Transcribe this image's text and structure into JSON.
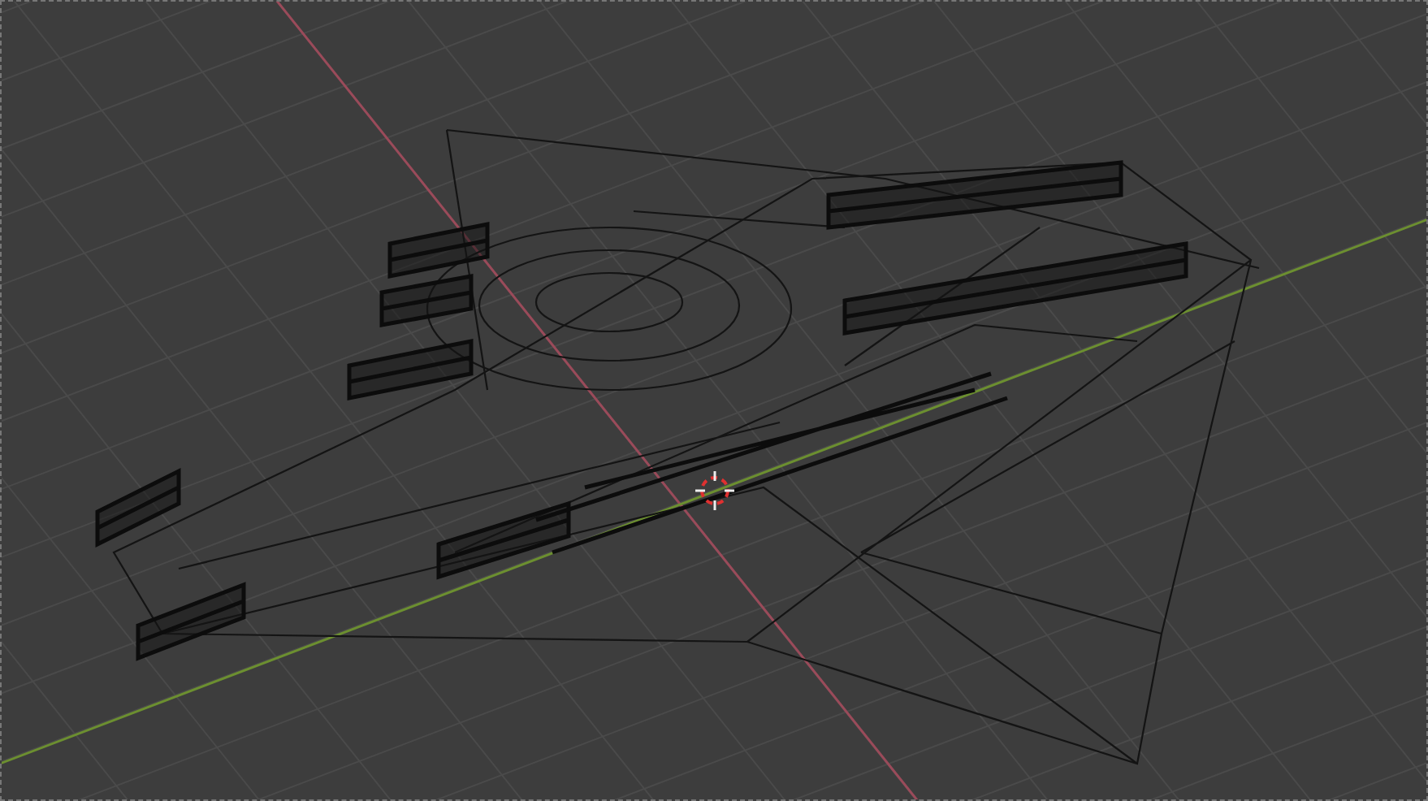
{
  "viewport": {
    "show_cursor": true
  }
}
